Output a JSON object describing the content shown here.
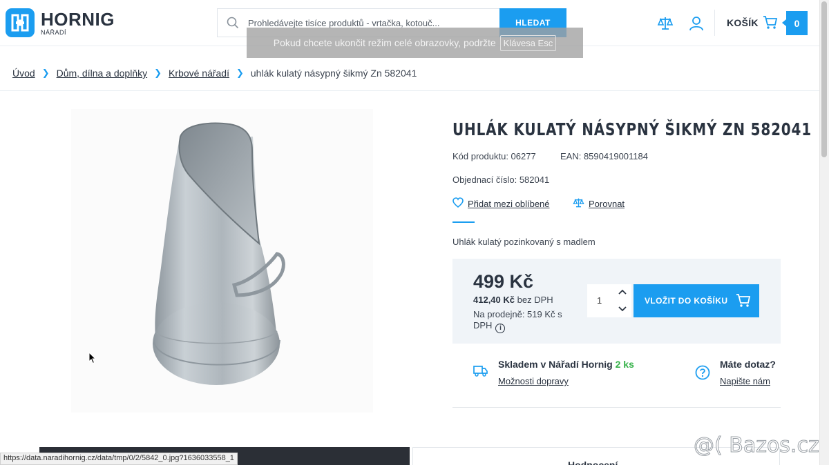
{
  "header": {
    "logo_name": "HORNIG",
    "logo_sub": "NÁŘADÍ",
    "search_placeholder": "Prohledávejte tisíce produktů - vrtačka, kotouč...",
    "search_button": "HLEDAT",
    "cart_label": "KOŠÍK",
    "cart_count": "0"
  },
  "fullscreen_notice": {
    "text": "Pokud chcete ukončit režim celé obrazovky, podržte",
    "key": "Klávesa Esc"
  },
  "breadcrumb": {
    "items": [
      "Úvod",
      "Dům, dílna a doplňky",
      "Krbové nářadí"
    ],
    "current": "uhlák kulatý násypný šikmý Zn 582041"
  },
  "product": {
    "title": "UHLÁK KULATÝ NÁSYPNÝ ŠIKMÝ ZN 582041",
    "code": "Kód produktu: 06277",
    "ean": "EAN: 8590419001184",
    "order_number": "Objednací číslo: 582041",
    "favorite_link": "Přidat mezi oblíbené",
    "compare_link": "Porovnat",
    "short_description": "Uhlák kulatý pozinkovaný s madlem",
    "price": "499 Kč",
    "price_novat_value": "412,40 Kč",
    "price_novat_label": "bez DPH",
    "store_price": "Na prodejně: 519 Kč s DPH",
    "quantity": "1",
    "add_to_cart": "VLOŽIT DO KOŠÍKU"
  },
  "availability": {
    "stock_text": "Skladem v Nářadí Hornig",
    "stock_count": "2 ks",
    "shipping_link": "Možnosti dopravy",
    "question_title": "Máte dotaz?",
    "question_link": "Napište nám"
  },
  "tabs": {
    "reviews": "Hodnocení"
  },
  "status_bar": {
    "url": "https://data.naradihornig.cz/data/tmp/0/2/5842_0.jpg?1636033558_1"
  },
  "watermark": "@( Bazos.cz",
  "colors": {
    "accent": "#1b9df0",
    "in_stock": "#36b24a",
    "text_dark": "#2a3340"
  }
}
